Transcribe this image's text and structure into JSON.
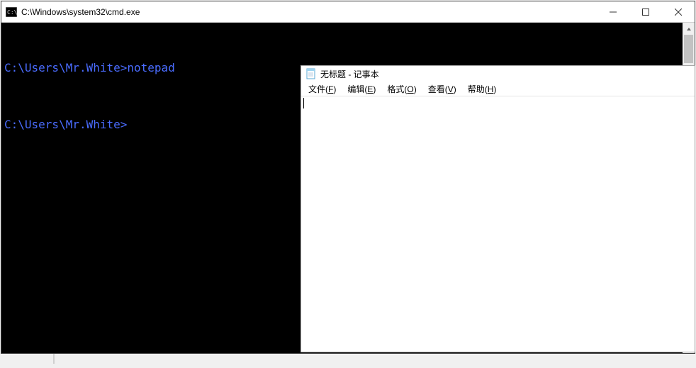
{
  "cmd": {
    "title": "C:\\Windows\\system32\\cmd.exe",
    "line1": "C:\\Users\\Mr.White>notepad",
    "line2": "C:\\Users\\Mr.White>"
  },
  "notepad": {
    "title": "无标题 - 记事本",
    "menu": {
      "file_pre": "文件(",
      "file_key": "F",
      "file_post": ")",
      "edit_pre": "编辑(",
      "edit_key": "E",
      "edit_post": ")",
      "format_pre": "格式(",
      "format_key": "O",
      "format_post": ")",
      "view_pre": "查看(",
      "view_key": "V",
      "view_post": ")",
      "help_pre": "帮助(",
      "help_key": "H",
      "help_post": ")"
    }
  }
}
